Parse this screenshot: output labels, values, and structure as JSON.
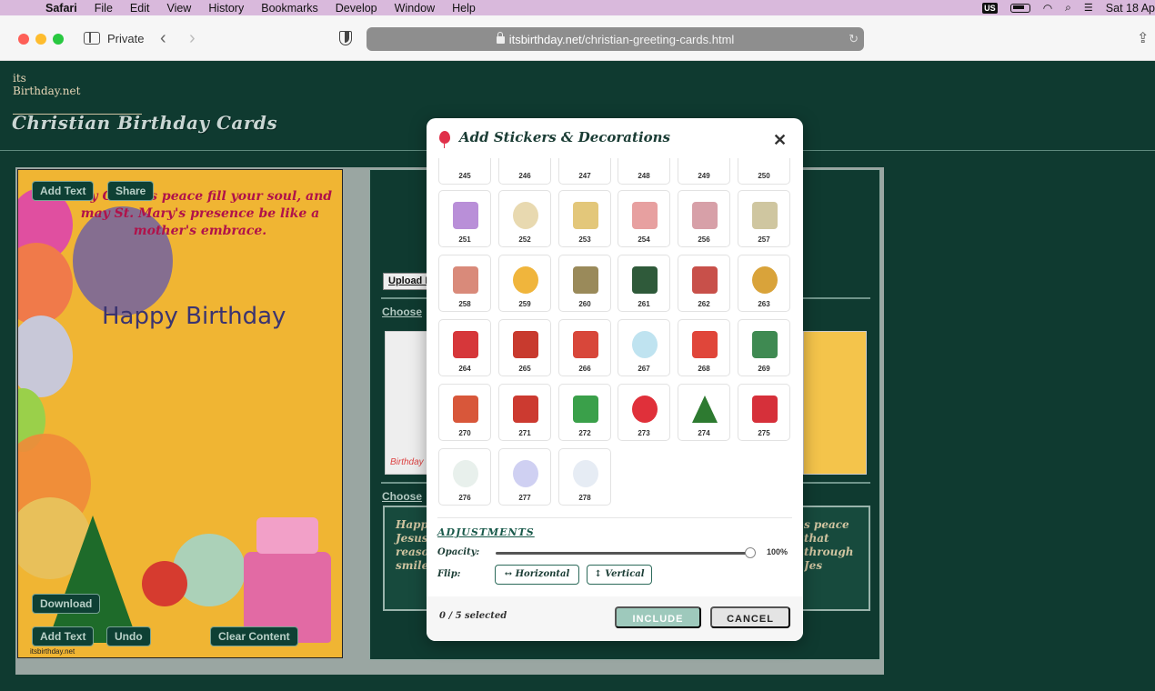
{
  "menubar": {
    "app": "Safari",
    "items": [
      "File",
      "Edit",
      "View",
      "History",
      "Bookmarks",
      "Develop",
      "Window",
      "Help"
    ],
    "input_source": "US",
    "clock": "Sat 18 Ap"
  },
  "browser": {
    "private_label": "Private",
    "url_domain": "itsbirthday.net",
    "url_path": "/christian-greeting-cards.html"
  },
  "site": {
    "logo_top": "its",
    "logo_bottom": "Birthday.net",
    "page_title": "Christian Birthday Cards"
  },
  "card": {
    "verse": "May Christ's peace fill your soul, and may St. Mary's presence be like a mother's embrace.",
    "greeting": "Happy Birthday",
    "watermark": "itsbirthday.net",
    "buttons": {
      "add_text_top": "Add Text",
      "share": "Share",
      "download": "Download",
      "add_text_bottom": "Add Text",
      "undo": "Undo",
      "clear_content": "Clear Content"
    }
  },
  "panel": {
    "upload": "Upload Image",
    "choose_1": "Choose",
    "choose_2": "Choose",
    "thumb_label": "Birthday",
    "msg_left": "Happ Jesus reaso smile",
    "msg_right": "s peace that through Jes"
  },
  "modal": {
    "title": "Add Stickers & Decorations",
    "stickers_partial": [
      "245",
      "246",
      "247",
      "248",
      "249",
      "250"
    ],
    "stickers": [
      {
        "num": "251",
        "icon": "garland-icon",
        "color": "#b98fd8"
      },
      {
        "num": "252",
        "icon": "crescent-moon-icon",
        "color": "#e8d9b0"
      },
      {
        "num": "253",
        "icon": "lanterns-icon",
        "color": "#e3c77a"
      },
      {
        "num": "254",
        "icon": "arch-lanterns-icon",
        "color": "#e7a0a0"
      },
      {
        "num": "256",
        "icon": "lanterns-icon",
        "color": "#d7a0a8"
      },
      {
        "num": "257",
        "icon": "hanging-lantern-icon",
        "color": "#cfc6a0"
      },
      {
        "num": "258",
        "icon": "bunting-icon",
        "color": "#d98a7a"
      },
      {
        "num": "259",
        "icon": "moon-mosque-icon",
        "color": "#f0b53c"
      },
      {
        "num": "260",
        "icon": "hanging-lantern-icon",
        "color": "#9a8a5a"
      },
      {
        "num": "261",
        "icon": "mosque-icon",
        "color": "#2f5a3a"
      },
      {
        "num": "262",
        "icon": "candle-icon",
        "color": "#c8504a"
      },
      {
        "num": "263",
        "icon": "bells-icon",
        "color": "#d9a33a"
      },
      {
        "num": "264",
        "icon": "bell-bow-icon",
        "color": "#d6373a"
      },
      {
        "num": "265",
        "icon": "santa-sack-icon",
        "color": "#c83a2e"
      },
      {
        "num": "266",
        "icon": "santa-icon",
        "color": "#d8473a"
      },
      {
        "num": "267",
        "icon": "snowman-icon",
        "color": "#bfe3f0"
      },
      {
        "num": "268",
        "icon": "bell-bow-icon",
        "color": "#e0463a"
      },
      {
        "num": "269",
        "icon": "holly-garland-icon",
        "color": "#3f8a52"
      },
      {
        "num": "270",
        "icon": "gift-stack-icon",
        "color": "#d8573a"
      },
      {
        "num": "271",
        "icon": "santa-icon",
        "color": "#cc3a30"
      },
      {
        "num": "272",
        "icon": "gift-icon",
        "color": "#3aa04a"
      },
      {
        "num": "273",
        "icon": "hearts-icon",
        "color": "#e0303a"
      },
      {
        "num": "274",
        "icon": "christmas-tree-icon",
        "color": "#2d7a30"
      },
      {
        "num": "275",
        "icon": "candy-cane-icon",
        "color": "#d6303a"
      },
      {
        "num": "276",
        "icon": "snowman-icon",
        "color": "#e8f0ec"
      },
      {
        "num": "277",
        "icon": "snowman-icon",
        "color": "#cfd0f2"
      },
      {
        "num": "278",
        "icon": "snowman-icon",
        "color": "#e6ecf4"
      }
    ],
    "adjustments_heading": "ADJUSTMENTS",
    "opacity_label": "Opacity:",
    "opacity_value": "100%",
    "opacity_level": 1.0,
    "flip_label": "Flip:",
    "flip_horizontal": "↔ Horizontal",
    "flip_vertical": "↕ Vertical",
    "selected_count": "0 / 5 selected",
    "include": "INCLUDE",
    "cancel": "CANCEL"
  }
}
